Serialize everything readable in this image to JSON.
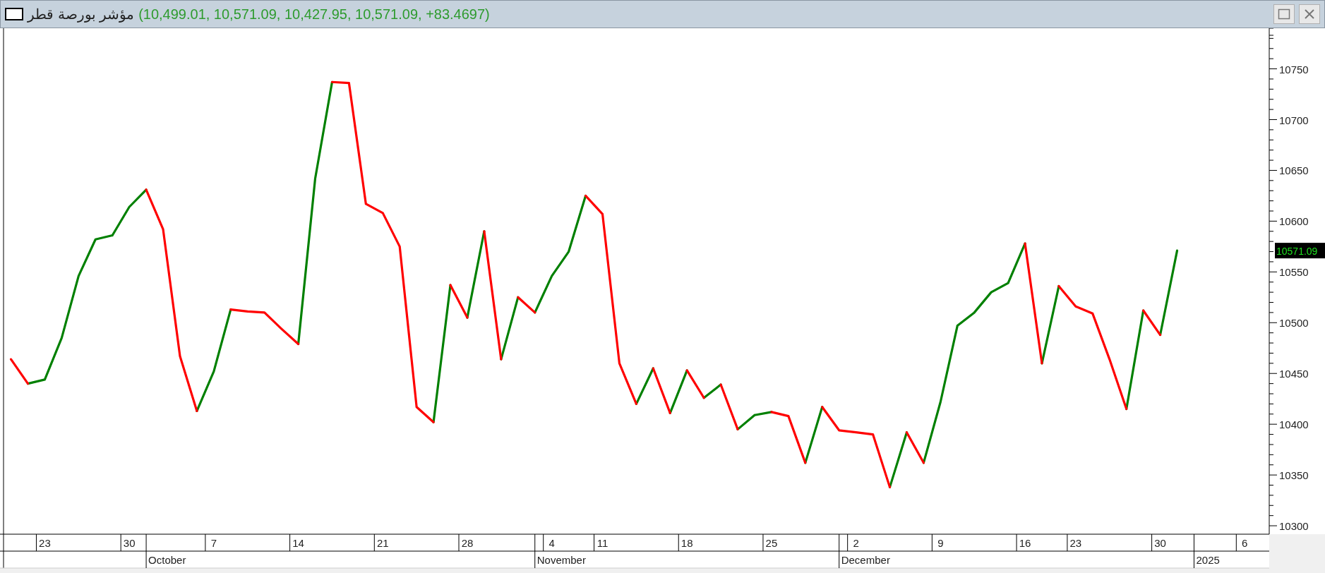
{
  "window": {
    "title_name": "مؤشر بورصة قطر",
    "title_values": "(10,499.01, 10,571.09, 10,427.95, 10,571.09, +83.4697)",
    "buttons": [
      {
        "kind": "maximize"
      },
      {
        "kind": "close"
      }
    ]
  },
  "chart": {
    "chart_data": {
      "type": "line",
      "categories": [
        null,
        null,
        "23",
        null,
        null,
        null,
        null,
        "30",
        null,
        null,
        null,
        null,
        "7",
        null,
        null,
        null,
        null,
        "14",
        null,
        null,
        null,
        null,
        "21",
        null,
        null,
        null,
        null,
        "28",
        null,
        null,
        null,
        null,
        "4",
        null,
        null,
        "11",
        null,
        null,
        null,
        null,
        "18",
        null,
        null,
        null,
        null,
        "25",
        null,
        null,
        null,
        null,
        "2",
        null,
        null,
        null,
        null,
        "9",
        null,
        null,
        null,
        null,
        "16",
        null,
        null,
        "23",
        null,
        null,
        null,
        null,
        "30",
        null,
        null,
        null,
        null,
        "6",
        null
      ],
      "series": [
        {
          "color": "#008000",
          "values": [
            null,
            10440,
            10444,
            10485,
            10546,
            10582,
            10586,
            10614,
            10631,
            null,
            null,
            10413,
            10452,
            10513,
            null,
            null,
            null,
            10479,
            10642,
            10737,
            null,
            null,
            null,
            null,
            null,
            10402,
            10537,
            10505,
            10590,
            10464,
            10525,
            10510,
            10546,
            10570,
            10625,
            null,
            null,
            10420,
            10455,
            10411,
            10453,
            10426,
            10439,
            10395,
            10409,
            10412,
            null,
            10362,
            10417,
            null,
            null,
            null,
            10338,
            10392,
            10362,
            10422,
            10497,
            10510,
            10530,
            10539,
            10578,
            10460,
            10536,
            null,
            null,
            null,
            10415,
            10512,
            10488,
            10571,
            null,
            null,
            null,
            null,
            null
          ]
        },
        {
          "color": "#ff0000",
          "values": [
            10464,
            10440,
            null,
            null,
            null,
            null,
            null,
            null,
            10631,
            10592,
            10467,
            10413,
            null,
            10513,
            10511,
            10510,
            10494,
            10479,
            null,
            10737,
            10736,
            10617,
            10608,
            10575,
            10417,
            10402,
            10537,
            10505,
            10590,
            10464,
            10525,
            10510,
            null,
            null,
            10625,
            10607,
            10460,
            10420,
            10455,
            10411,
            10453,
            10426,
            10439,
            10395,
            null,
            10412,
            10408,
            10362,
            10417,
            10394,
            10392,
            10390,
            10338,
            10392,
            10362,
            null,
            null,
            null,
            null,
            null,
            10578,
            10460,
            10536,
            10516,
            10509,
            10464,
            10415,
            10512,
            10488,
            null,
            null,
            null,
            null,
            null,
            null
          ]
        }
      ],
      "ylim": [
        10291.7,
        10790
      ],
      "yticks": [
        10300,
        10350,
        10400,
        10450,
        10500,
        10550,
        10600,
        10650,
        10700,
        10750
      ]
    },
    "periods": [
      "October",
      "November",
      "December",
      "2025"
    ],
    "last_price_tag": "10571.09"
  }
}
